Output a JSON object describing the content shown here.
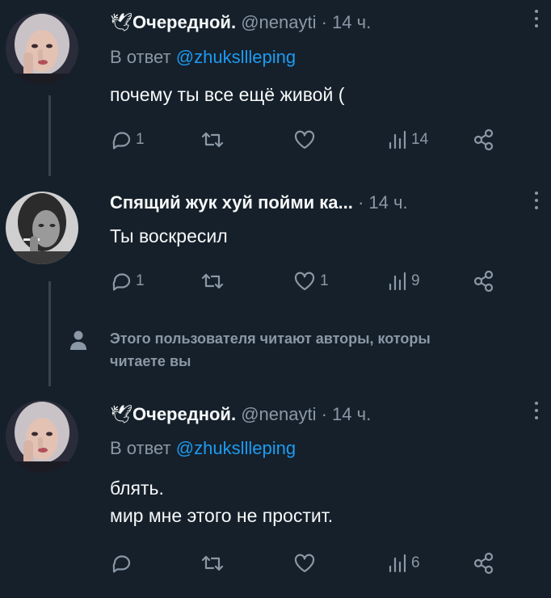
{
  "colors": {
    "background": "#15202b",
    "text": "#f7f9f9",
    "muted": "#8b98a5",
    "link": "#1d9bf0",
    "thread_line": "#38444d"
  },
  "tweets": [
    {
      "dove": "🕊",
      "name": "Очередной.",
      "handle": "@nenayti",
      "sep": "·",
      "time": "14 ч.",
      "reply_prefix": "В ответ",
      "reply_handle": "@zhuksllleping",
      "text": "почему ты все ещё живой (",
      "counts": {
        "reply": "1",
        "retweet": "",
        "like": "",
        "views": "14"
      }
    },
    {
      "name": "Спящий жук хуй пойми ка...",
      "sep": "·",
      "time": "14 ч.",
      "text": "Ты воскресил",
      "counts": {
        "reply": "1",
        "retweet": "",
        "like": "1",
        "views": "9"
      }
    },
    {
      "dove": "🕊",
      "name": "Очередной.",
      "handle": "@nenayti",
      "sep": "·",
      "time": "14 ч.",
      "reply_prefix": "В ответ",
      "reply_handle": "@zhuksllleping",
      "text": "блять.\nмир мне этого не простит.",
      "counts": {
        "reply": "",
        "retweet": "",
        "like": "",
        "views": "6"
      }
    }
  ],
  "notice": {
    "icon": "person-icon",
    "line1": "Этого пользователя читают авторы, которы",
    "line2": "читаете вы"
  }
}
